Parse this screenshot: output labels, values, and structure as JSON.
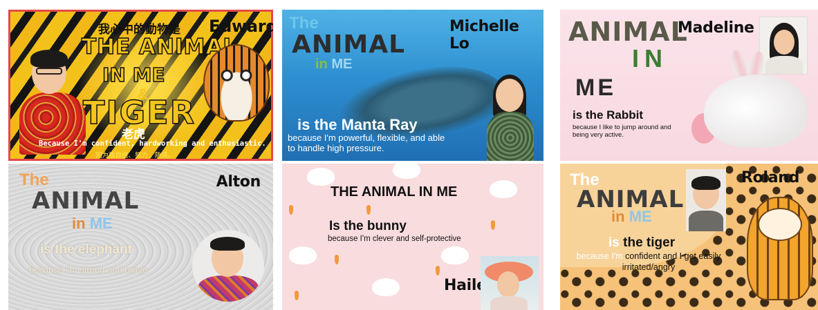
{
  "accent_colors": {
    "selection_outline": "#e34a4a",
    "tiger_yellow": "#f4c51d"
  },
  "tiles": [
    {
      "student": "Edward",
      "zh_heading": "我心中的動物是",
      "line1": "THE ANIMAL",
      "line2": "IN ME",
      "amp": "&",
      "animal": "TIGER",
      "animal_zh": "老虎",
      "because": "Because I'm confident, hardworking and enthusiastic.",
      "because_zh": "因为我自信、努力、熱情。",
      "selected": true
    },
    {
      "student": "Michelle Lo",
      "the": "The",
      "wordmark": "ANIMAL",
      "in": "in",
      "me": "ME",
      "animal": "is the Manta Ray",
      "because": "because I'm powerful, flexible, and able to handle high pressure."
    },
    {
      "student": "Madeline",
      "wordmark": "ANIMAL",
      "in": "IN",
      "me": "ME",
      "animal": "is the Rabbit",
      "because": "because I like to jump around and being very active."
    },
    {
      "student": "Alton",
      "the": "The",
      "wordmark": "ANIMAL",
      "in": "in",
      "me": "ME",
      "animal": "is the elephant",
      "because": "because I'm strong and brave"
    },
    {
      "student": "Hailey",
      "title": "THE ANIMAL IN ME",
      "animal": "Is the bunny",
      "because": "because I'm clever and self-protective"
    },
    {
      "student": "Roland",
      "the": "The",
      "wordmark": "ANIMAL",
      "in": "in",
      "me": "ME",
      "animal_is": "is",
      "animal": "the tiger",
      "because_a": "because I'm",
      "because_b": "confident",
      "because_c": "and I get easily irritated/angry"
    }
  ],
  "icons": [
    "tiger-illustration",
    "manta-ray-illustration",
    "rabbit-illustration",
    "bunny-pattern",
    "cartoon-tiger-illustration",
    "student-photo"
  ]
}
